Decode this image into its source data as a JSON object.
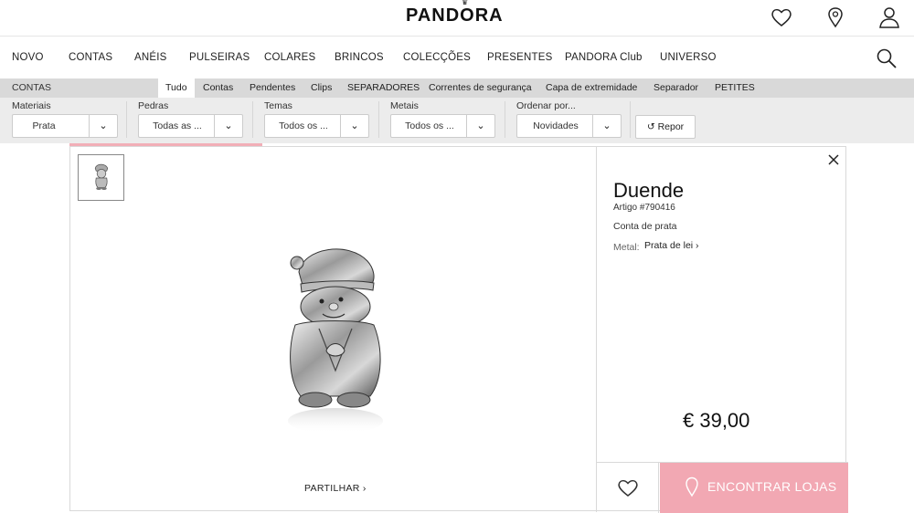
{
  "header": {
    "logo": "PANDORA",
    "icons": [
      "heart-icon",
      "location-pin-icon",
      "user-icon"
    ]
  },
  "nav": {
    "items": [
      "NOVO",
      "CONTAS",
      "ANÉIS",
      "PULSEIRAS",
      "COLARES",
      "BRINCOS",
      "COLECÇÕES",
      "PRESENTES",
      "PANDORA Club",
      "UNIVERSO"
    ],
    "search_icon": "search-icon"
  },
  "subnav": {
    "title": "CONTAS",
    "tabs": [
      "Tudo",
      "Contas",
      "Pendentes",
      "Clips",
      "SEPARADORES",
      "Correntes de segurança",
      "Capa de extremidade",
      "Separador",
      "PETITES"
    ],
    "active_tab": "Tudo"
  },
  "filters": {
    "groups": [
      {
        "label": "Materiais",
        "value": "Prata"
      },
      {
        "label": "Pedras",
        "value": "Todas as ..."
      },
      {
        "label": "Temas",
        "value": "Todos os ..."
      },
      {
        "label": "Metais",
        "value": "Todos os ..."
      },
      {
        "label": "Ordenar por...",
        "value": "Novidades"
      }
    ],
    "dropdown_glyph": "⌄",
    "reset_label": "Repor",
    "reset_icon": "refresh-icon"
  },
  "product": {
    "name": "Duende",
    "sku": "Artigo #790416",
    "type": "Conta de prata",
    "metal_label": "Metal:",
    "metal_value": "Prata de lei",
    "price": "€ 39,00",
    "share_label": "PARTILHAR",
    "find_stores_label": "ENCONTRAR LOJAS"
  },
  "colors": {
    "accent_pink": "#f2a8b3",
    "filter_bg": "#ececec",
    "subnav_bg": "#d9d9d9"
  }
}
